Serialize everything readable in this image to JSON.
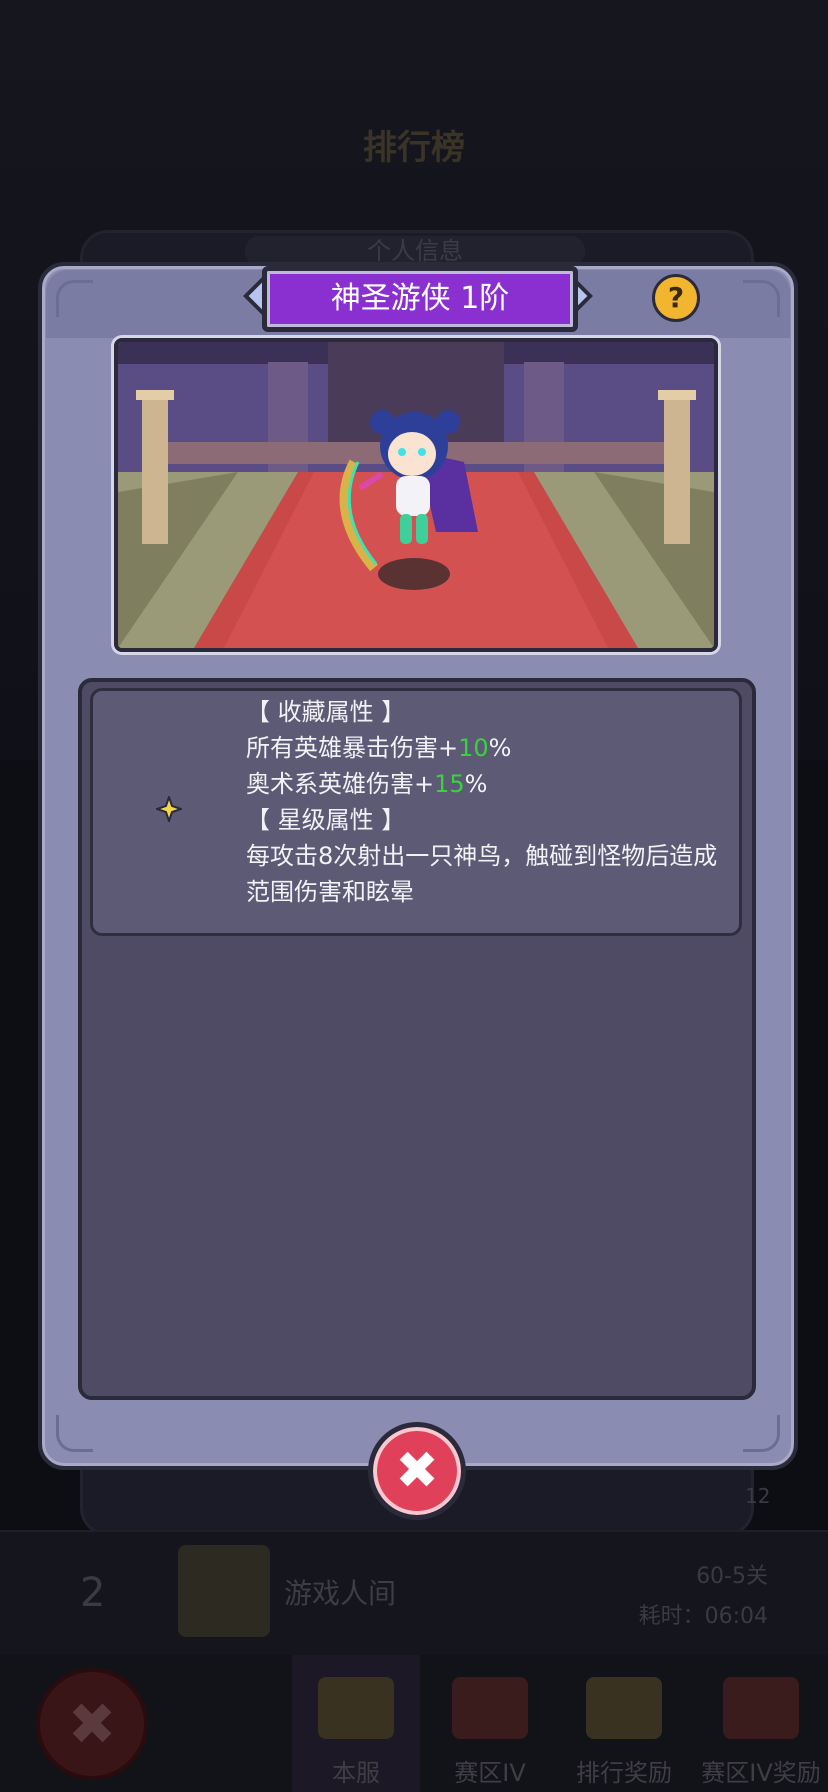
{
  "background": {
    "title": "排行榜",
    "panel_tab": "个人信息",
    "rank_row": {
      "rank": "2",
      "player_name": "游戏人间",
      "stage": "60-5关",
      "time": "耗时：06:04"
    },
    "side_number": "12",
    "tabs": [
      {
        "label": "本服",
        "icon": "crown-icon"
      },
      {
        "label": "赛区IV",
        "icon": "shield-crown-icon"
      },
      {
        "label": "排行奖励",
        "icon": "crown-icon"
      },
      {
        "label": "赛区IV奖励",
        "icon": "shield-crown-icon"
      }
    ]
  },
  "modal": {
    "title": "神圣游侠 1阶",
    "help_icon": "?",
    "collection_header": "【 收藏属性 】",
    "collection_lines": [
      {
        "text": "所有英雄暴击伤害+",
        "value": "10",
        "suffix": "%"
      },
      {
        "text": "奥术系英雄伤害+",
        "value": "15",
        "suffix": "%"
      }
    ],
    "star_header": "【 星级属性 】",
    "star_desc": "每攻击8次射出一只神鸟，触碰到怪物后造成范围伤害和眩晕",
    "close_icon": "✖"
  },
  "colors": {
    "title_plate": "#8a2fd0",
    "modal_bg": "#8b8cb2",
    "value_green": "#39d33d",
    "close_red": "#e0405a"
  }
}
